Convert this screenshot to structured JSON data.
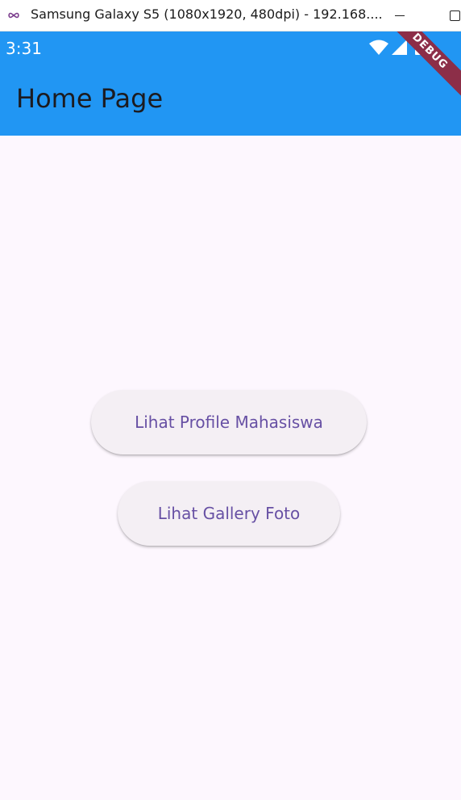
{
  "window": {
    "title": "Samsung Galaxy S5 (1080x1920, 480dpi) - 192.168....",
    "app_icon": "infinity-icon",
    "controls": [
      "minimize-icon",
      "maximize-icon"
    ]
  },
  "status_bar": {
    "time": "3:31",
    "icons": [
      "wifi-icon",
      "signal-icon",
      "battery-icon"
    ]
  },
  "debug_banner": {
    "label": "DEBUG"
  },
  "app_bar": {
    "title": "Home Page"
  },
  "main": {
    "buttons": [
      {
        "label": "Lihat Profile Mahasiswa"
      },
      {
        "label": "Lihat Gallery Foto"
      }
    ]
  },
  "colors": {
    "app_bar": "#2196f3",
    "background": "#fdf7fe",
    "button_text": "#6750a4",
    "button_bg": "#f4eff4",
    "debug_banner": "#8c2e48"
  }
}
